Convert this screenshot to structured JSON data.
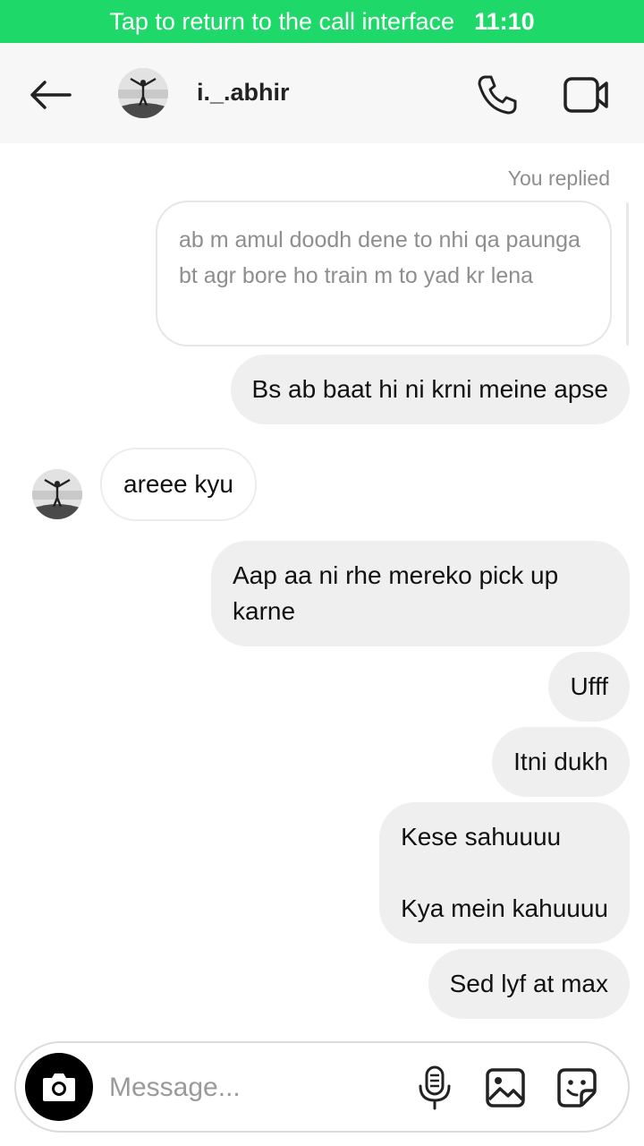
{
  "call_banner": {
    "text": "Tap to return to the call interface",
    "time": "11:10"
  },
  "header": {
    "username": "i._.abhir"
  },
  "thread": {
    "replied_label": "You replied",
    "reply_quote": "ab m amul doodh dene to nhi qa paunga bt agr bore ho train m to yad kr lena",
    "messages": [
      {
        "from": "me",
        "text": "Bs ab baat hi ni krni meine apse"
      },
      {
        "from": "them",
        "text": "areee kyu"
      },
      {
        "from": "me",
        "text": "Aap aa ni rhe mereko pick up karne"
      },
      {
        "from": "me",
        "text": "Ufff"
      },
      {
        "from": "me",
        "text": "Itni dukh"
      },
      {
        "from": "me",
        "text": "Kese sahuuuu\n\nKya mein kahuuuu"
      },
      {
        "from": "me",
        "text": "Sed lyf at max"
      }
    ]
  },
  "composer": {
    "placeholder": "Message..."
  },
  "colors": {
    "call_banner": "#1fd86a",
    "bubble_me": "#efefef",
    "bubble_them": "#ffffff"
  },
  "icons": [
    "back-arrow-icon",
    "phone-icon",
    "video-camera-icon",
    "camera-icon",
    "microphone-icon",
    "gallery-icon",
    "sticker-icon"
  ]
}
